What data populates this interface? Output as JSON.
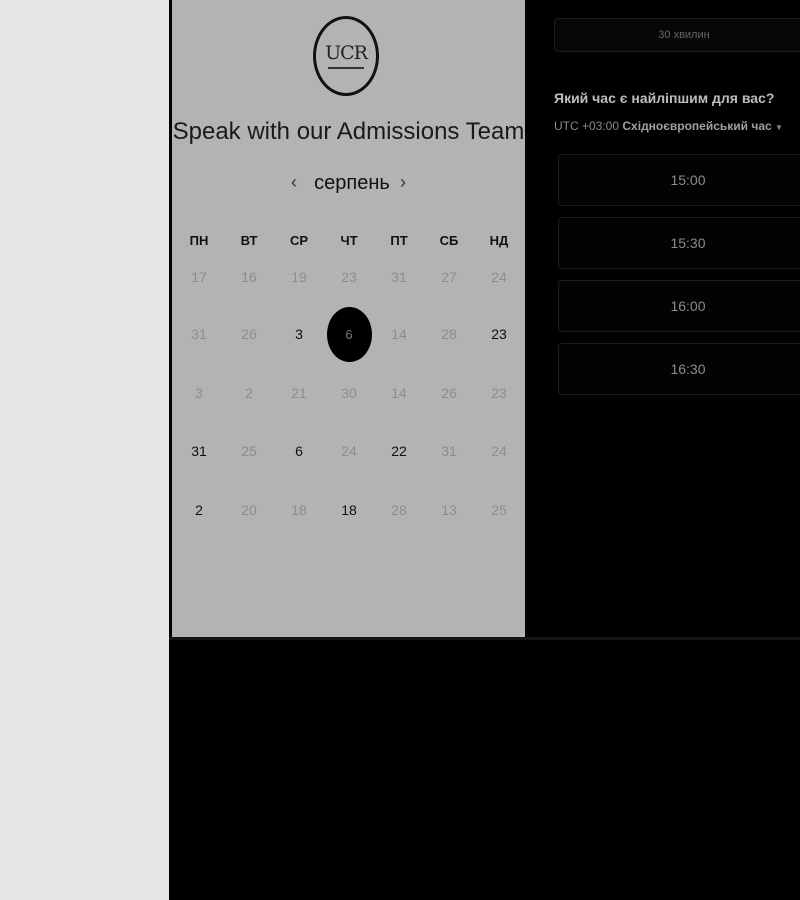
{
  "calendar": {
    "title": "Speak with our Admissions Team",
    "month": "серпень",
    "prev_icon": "‹",
    "next_icon": "›",
    "weekdays": [
      "ПН",
      "ВТ",
      "СР",
      "ЧТ",
      "ПТ",
      "СБ",
      "НД"
    ],
    "first_row": [
      "17",
      "16",
      "19",
      "23",
      "31",
      "27",
      "24"
    ],
    "rows": [
      [
        {
          "d": "31",
          "s": "d"
        },
        {
          "d": "26",
          "s": "d"
        },
        {
          "d": "3",
          "s": "a"
        },
        {
          "d": "6",
          "s": "sel"
        },
        {
          "d": "14",
          "s": "d"
        },
        {
          "d": "28",
          "s": "d"
        },
        {
          "d": "23",
          "s": "a"
        }
      ],
      [
        {
          "d": "3",
          "s": "d"
        },
        {
          "d": "2",
          "s": "d"
        },
        {
          "d": "21",
          "s": "d"
        },
        {
          "d": "30",
          "s": "d"
        },
        {
          "d": "14",
          "s": "d"
        },
        {
          "d": "26",
          "s": "d"
        },
        {
          "d": "23",
          "s": "d"
        }
      ],
      [
        {
          "d": "31",
          "s": "a"
        },
        {
          "d": "25",
          "s": "d"
        },
        {
          "d": "6",
          "s": "a"
        },
        {
          "d": "24",
          "s": "d"
        },
        {
          "d": "22",
          "s": "a"
        },
        {
          "d": "31",
          "s": "d"
        },
        {
          "d": "24",
          "s": "d"
        }
      ],
      [
        {
          "d": "2",
          "s": "a"
        },
        {
          "d": "20",
          "s": "d"
        },
        {
          "d": "18",
          "s": "d"
        },
        {
          "d": "18",
          "s": "a"
        },
        {
          "d": "28",
          "s": "d"
        },
        {
          "d": "13",
          "s": "d"
        },
        {
          "d": "25",
          "s": "d"
        }
      ]
    ]
  },
  "logo": {
    "text": "UCR"
  },
  "scheduler": {
    "duration": "30 хвилин",
    "question": "Який час є найліпшим для вас?",
    "timezone_offset": "UTC +03:00",
    "timezone_name": "Східноєвропейський час",
    "timezone_caret": "▼",
    "slots": [
      "15:00",
      "15:30",
      "16:00",
      "16:30"
    ]
  }
}
